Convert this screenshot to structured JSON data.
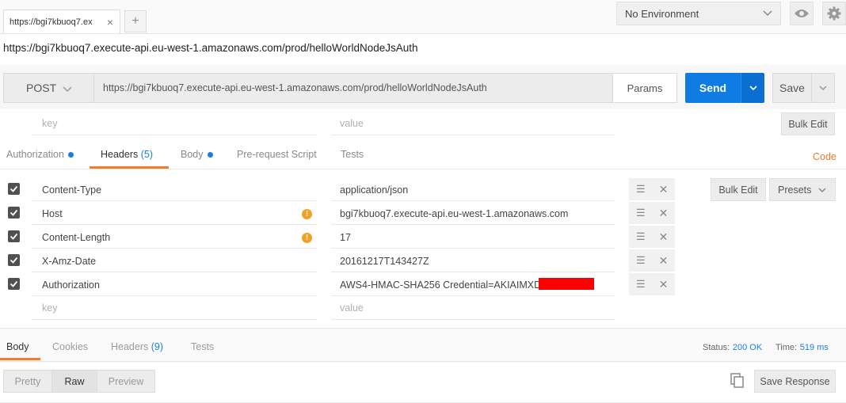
{
  "tab": {
    "title": "https://bgi7kbuoq7.ex",
    "close": "×",
    "add": "+"
  },
  "environment": {
    "selected": "No Environment"
  },
  "request_title": "https://bgi7kbuoq7.execute-api.eu-west-1.amazonaws.com/prod/helloWorldNodeJsAuth",
  "request": {
    "method": "POST",
    "url": "https://bgi7kbuoq7.execute-api.eu-west-1.amazonaws.com/prod/helloWorldNodeJsAuth",
    "params_label": "Params",
    "send_label": "Send",
    "save_label": "Save"
  },
  "params_row": {
    "key_placeholder": "key",
    "value_placeholder": "value",
    "bulk_edit": "Bulk Edit"
  },
  "request_tabs": {
    "authorization": "Authorization",
    "headers": "Headers",
    "headers_count": "(5)",
    "body": "Body",
    "prerequest": "Pre-request Script",
    "tests": "Tests",
    "code": "Code"
  },
  "headers": [
    {
      "key": "Content-Type",
      "value": "application/json",
      "warning": false
    },
    {
      "key": "Host",
      "value": "bgi7kbuoq7.execute-api.eu-west-1.amazonaws.com",
      "warning": true
    },
    {
      "key": "Content-Length",
      "value": "17",
      "warning": true
    },
    {
      "key": "X-Amz-Date",
      "value": "20161217T143427Z",
      "warning": false
    },
    {
      "key": "Authorization",
      "value": "AWS4-HMAC-SHA256 Credential=AKIAIMXDJ6",
      "warning": false
    }
  ],
  "headers_new_row": {
    "key_placeholder": "key",
    "value_placeholder": "value"
  },
  "headers_actions": {
    "bulk_edit": "Bulk Edit",
    "presets": "Presets"
  },
  "response_tabs": {
    "body": "Body",
    "cookies": "Cookies",
    "headers": "Headers",
    "headers_count": "(9)",
    "tests": "Tests"
  },
  "response_status": {
    "status_label": "Status:",
    "status_value": "200 OK",
    "time_label": "Time:",
    "time_value": "519 ms"
  },
  "response_view": {
    "pretty": "Pretty",
    "raw": "Raw",
    "preview": "Preview",
    "save_response": "Save Response"
  },
  "colors": {
    "accent_blue": "#0f7ce4",
    "tab_underline": "#f27c2a",
    "warning": "#f0a023",
    "code_link": "#e07b2a",
    "redaction": "#ff0000"
  }
}
